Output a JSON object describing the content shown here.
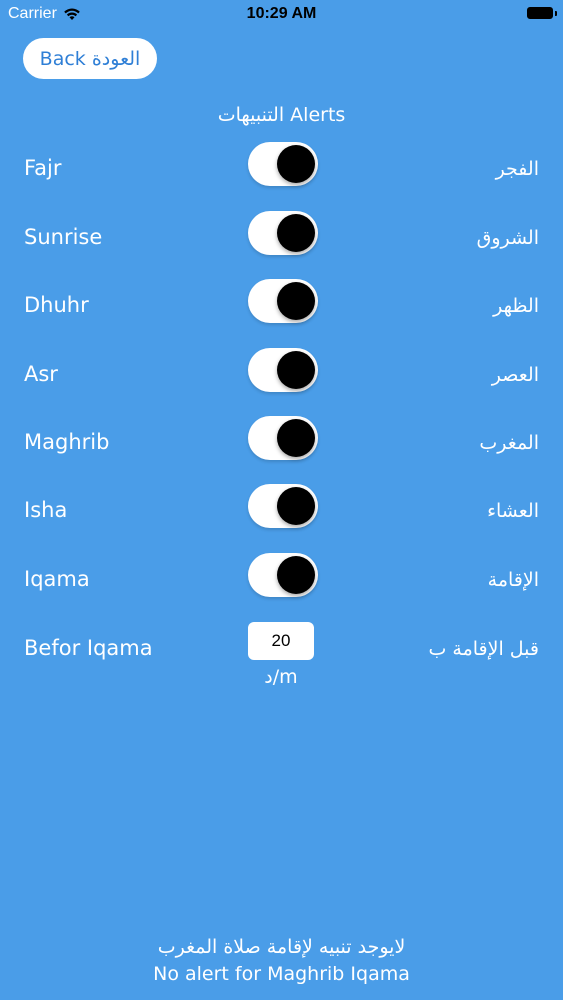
{
  "status_bar": {
    "carrier": "Carrier",
    "time": "10:29 AM",
    "wifi_icon": "wifi-icon",
    "battery_icon": "battery-icon"
  },
  "back_button": {
    "label": "Back العودة"
  },
  "alerts_title": "التنبيهات Alerts",
  "rows": [
    {
      "en": "Fajr",
      "ar": "الفجر",
      "on": true
    },
    {
      "en": "Sunrise",
      "ar": "الشروق",
      "on": true
    },
    {
      "en": "Dhuhr",
      "ar": "الظهر",
      "on": true
    },
    {
      "en": "Asr",
      "ar": "العصر",
      "on": true
    },
    {
      "en": "Maghrib",
      "ar": "المغرب",
      "on": true
    },
    {
      "en": "Isha",
      "ar": "العشاء",
      "on": true
    },
    {
      "en": "Iqama",
      "ar": "الإقامة",
      "on": true
    }
  ],
  "before_iqama": {
    "en": "Befor Iqama",
    "ar": "قبل الإقامة ب",
    "value": "20",
    "unit": "د/m"
  },
  "footer": {
    "line_ar": "لايوجد تنبيه لإقامة صلاة المغرب",
    "line_en": "No alert for Maghrib Iqama"
  },
  "colors": {
    "background": "#4a9de8",
    "button_text": "#2f7fd6",
    "toggle_knob": "#000000"
  }
}
